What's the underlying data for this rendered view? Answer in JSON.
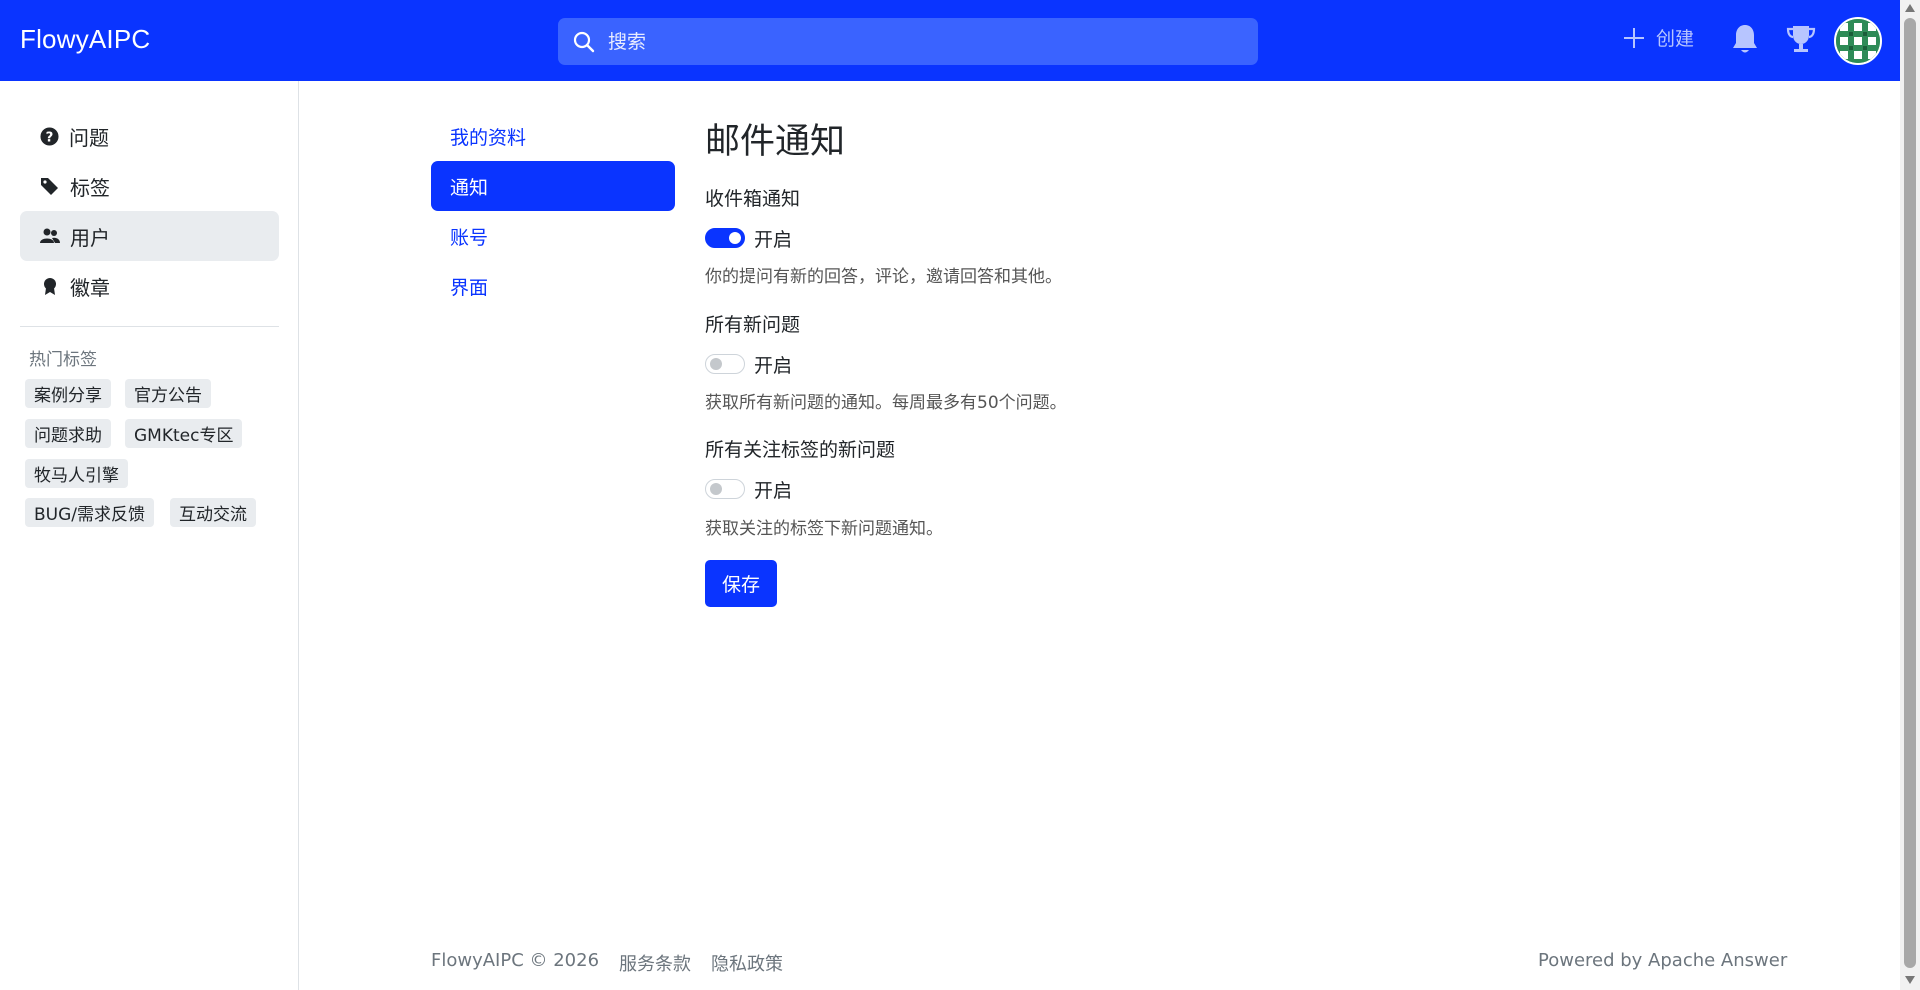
{
  "header": {
    "brand": "FlowyAIPC",
    "search_placeholder": "搜索",
    "create_label": "创建",
    "colors": {
      "primary": "#0a34ff",
      "search_bg": "#3a63ff"
    }
  },
  "sidebar": {
    "items": [
      {
        "label": "问题",
        "icon": "question-circle-icon"
      },
      {
        "label": "标签",
        "icon": "tags-icon"
      },
      {
        "label": "用户",
        "icon": "people-icon",
        "active": true
      },
      {
        "label": "徽章",
        "icon": "award-icon"
      }
    ],
    "hot_tags_title": "热门标签",
    "hot_tags": [
      "案例分享",
      "官方公告",
      "问题求助",
      "GMKtec专区",
      "牧马人引擎",
      "BUG/需求反馈",
      "互动交流"
    ]
  },
  "settings_nav": {
    "items": [
      {
        "label": "我的资料"
      },
      {
        "label": "通知",
        "active": true
      },
      {
        "label": "账号"
      },
      {
        "label": "界面"
      }
    ]
  },
  "main": {
    "title": "邮件通知",
    "sections": [
      {
        "label": "收件箱通知",
        "switch_label": "开启",
        "enabled": true,
        "help": "你的提问有新的回答，评论，邀请回答和其他。"
      },
      {
        "label": "所有新问题",
        "switch_label": "开启",
        "enabled": false,
        "help": "获取所有新问题的通知。每周最多有50个问题。"
      },
      {
        "label": "所有关注标签的新问题",
        "switch_label": "开启",
        "enabled": false,
        "help": "获取关注的标签下新问题通知。"
      }
    ],
    "save_label": "保存"
  },
  "footer": {
    "copyright": "FlowyAIPC © 2026",
    "terms": "服务条款",
    "privacy": "隐私政策",
    "powered": "Powered by Apache Answer"
  }
}
